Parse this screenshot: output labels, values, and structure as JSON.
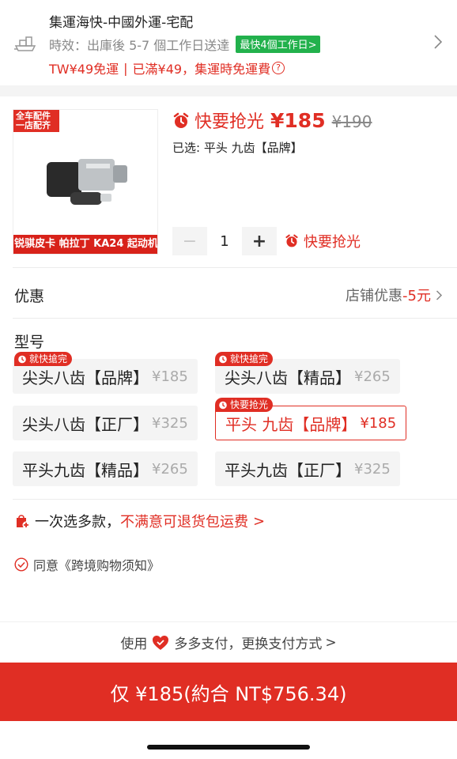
{
  "shipping": {
    "title": "集運海快-中國外運-宅配",
    "timing": "時效：出庫後 5-7 個工作日送達",
    "fast_badge": "最快4個工作日>",
    "free_text": "TW¥49免運",
    "sep": "|",
    "threshold_text": "已滿¥49，集運時免運費",
    "help_glyph": "?",
    "icon": "ship-icon"
  },
  "product": {
    "image_tag_line1": "全车配件",
    "image_tag_line2": "一店配齐",
    "image_caption": "锐骐皮卡 帕拉丁 KA24 起动机",
    "price_label": "快要抢光",
    "price_now": "¥185",
    "price_old": "¥190",
    "selected": "已选: 平头 九齿【品牌】",
    "quantity": "1",
    "minus": "−",
    "plus": "+",
    "qty_hint": "快要抢光"
  },
  "promo": {
    "label": "优惠",
    "value_prefix": "店铺优惠",
    "value_amount": "-5元"
  },
  "model": {
    "label": "型号",
    "options": [
      {
        "name": "尖头八齿【品牌】",
        "price": "¥185",
        "tag": "就快搶完"
      },
      {
        "name": "尖头八齿【精品】",
        "price": "¥265",
        "tag": "就快搶完"
      },
      {
        "name": "尖头八齿【正厂】",
        "price": "¥325",
        "tag": ""
      },
      {
        "name": "平头 九齿【品牌】",
        "price": "¥185",
        "tag": "快要抢光",
        "selected": true
      },
      {
        "name": "平头九齿【精品】",
        "price": "¥265",
        "tag": ""
      },
      {
        "name": "平头九齿【正厂】",
        "price": "¥325",
        "tag": ""
      }
    ]
  },
  "multi": {
    "text": "一次选多款，",
    "highlight": "不满意可退货包运费",
    "chev": ">"
  },
  "agree": {
    "text": "同意《跨境购物须知》"
  },
  "pay": {
    "prefix": "使用",
    "method": "多多支付，更换支付方式",
    "chev": ">"
  },
  "buy": {
    "label": "仅 ¥185(約合 NT$756.34)"
  },
  "colors": {
    "accent": "#e02e24",
    "green": "#22b14c"
  }
}
